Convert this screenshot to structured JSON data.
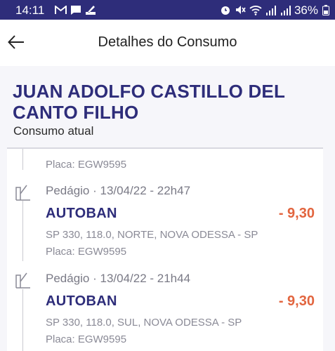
{
  "status_bar": {
    "time": "14:11",
    "battery": "36%",
    "left_icons": [
      "gmail-icon",
      "message-icon",
      "brush-app-icon"
    ],
    "right_icons": [
      "alarm-icon",
      "mute-icon",
      "wifi-icon",
      "signal-icon",
      "signal-icon"
    ]
  },
  "header": {
    "title": "Detalhes do Consumo"
  },
  "customer": {
    "name": "JUAN ADOLFO CASTILLO DEL CANTO FILHO",
    "consumo_label": "Consumo atual"
  },
  "partial_item": {
    "plate": "Placa: EGW9595"
  },
  "transactions": [
    {
      "header": "Pedágio · 13/04/22 - 22h47",
      "merchant": "AUTOBAN",
      "amount": "- 9,30",
      "address": "SP 330, 118.0, NORTE, NOVA ODESSA - SP",
      "plate": "Placa: EGW9595"
    },
    {
      "header": "Pedágio · 13/04/22 - 21h44",
      "merchant": "AUTOBAN",
      "amount": "- 9,30",
      "address": "SP 330, 118.0, SUL, NOVA ODESSA - SP",
      "plate": "Placa: EGW9595"
    }
  ],
  "colors": {
    "brand": "#2e2d7a",
    "amount": "#e2653f",
    "muted_text": "#8a8a96"
  }
}
